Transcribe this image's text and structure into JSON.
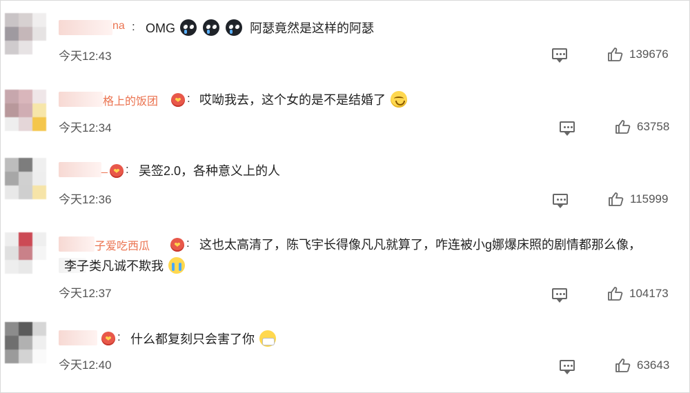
{
  "comments": [
    {
      "name_fragment": "na",
      "text": "OMG",
      "text_after_emoji": "阿瑟竟然是这样的阿瑟",
      "emoji": [
        "crying-dark",
        "crying-dark",
        "crying-dark"
      ],
      "time": "今天12:43",
      "likes": "139676",
      "avatar_colors": [
        "#c9c4c6",
        "#d7d1d1",
        "#f0eeee",
        "#9f9aa0",
        "#c5b7b9",
        "#e6e3e3",
        "#cfcbcd",
        "#e7e3e4",
        "#ffffff"
      ]
    },
    {
      "name_fragment": "格上的饭团",
      "text": "哎呦我去，这个女的是不是结婚了",
      "emoji": [
        "smile"
      ],
      "time": "今天12:34",
      "likes": "63758",
      "avatar_colors": [
        "#c7a7ad",
        "#d9b6bb",
        "#efe6e8",
        "#b8989b",
        "#d0adb3",
        "#f7e6a9",
        "#eeeeee",
        "#e4d6d8",
        "#f4c64c"
      ]
    },
    {
      "name_fragment": "_",
      "text": "吴签2.0，各种意义上的人",
      "emoji": [],
      "time": "今天12:36",
      "likes": "115999",
      "avatar_colors": [
        "#bdbdbd",
        "#7d7d7d",
        "#efefef",
        "#a7a7a7",
        "#d0d0d0",
        "#eeeeee",
        "#e8e8e8",
        "#cfcfcf",
        "#f6e4a8"
      ]
    },
    {
      "name_fragment": "子爱吃西瓜",
      "text": "这也太高清了，陈飞宇长得像凡凡就算了，咋连被小g娜爆床照的剧情都那么像，",
      "text_line2": "李子类凡诚不欺我",
      "emoji": [
        "cry"
      ],
      "time": "今天12:37",
      "likes": "104173",
      "avatar_colors": [
        "#eeeeee",
        "#cc4a55",
        "#efefef",
        "#e0e0e0",
        "#c98189",
        "#f5f5f5",
        "#eeeeee",
        "#e8e8e8",
        "#ffffff"
      ]
    },
    {
      "name_fragment": "",
      "text": "什么都复刻只会害了你",
      "emoji": [
        "mask"
      ],
      "time": "今天12:40",
      "likes": "63643",
      "avatar_colors": [
        "#8c8c8c",
        "#5b5b5b",
        "#d6d6d6",
        "#6f6f6f",
        "#b1b1b1",
        "#efefef",
        "#9b9b9b",
        "#d3d3d3",
        "#fafafa"
      ]
    }
  ]
}
